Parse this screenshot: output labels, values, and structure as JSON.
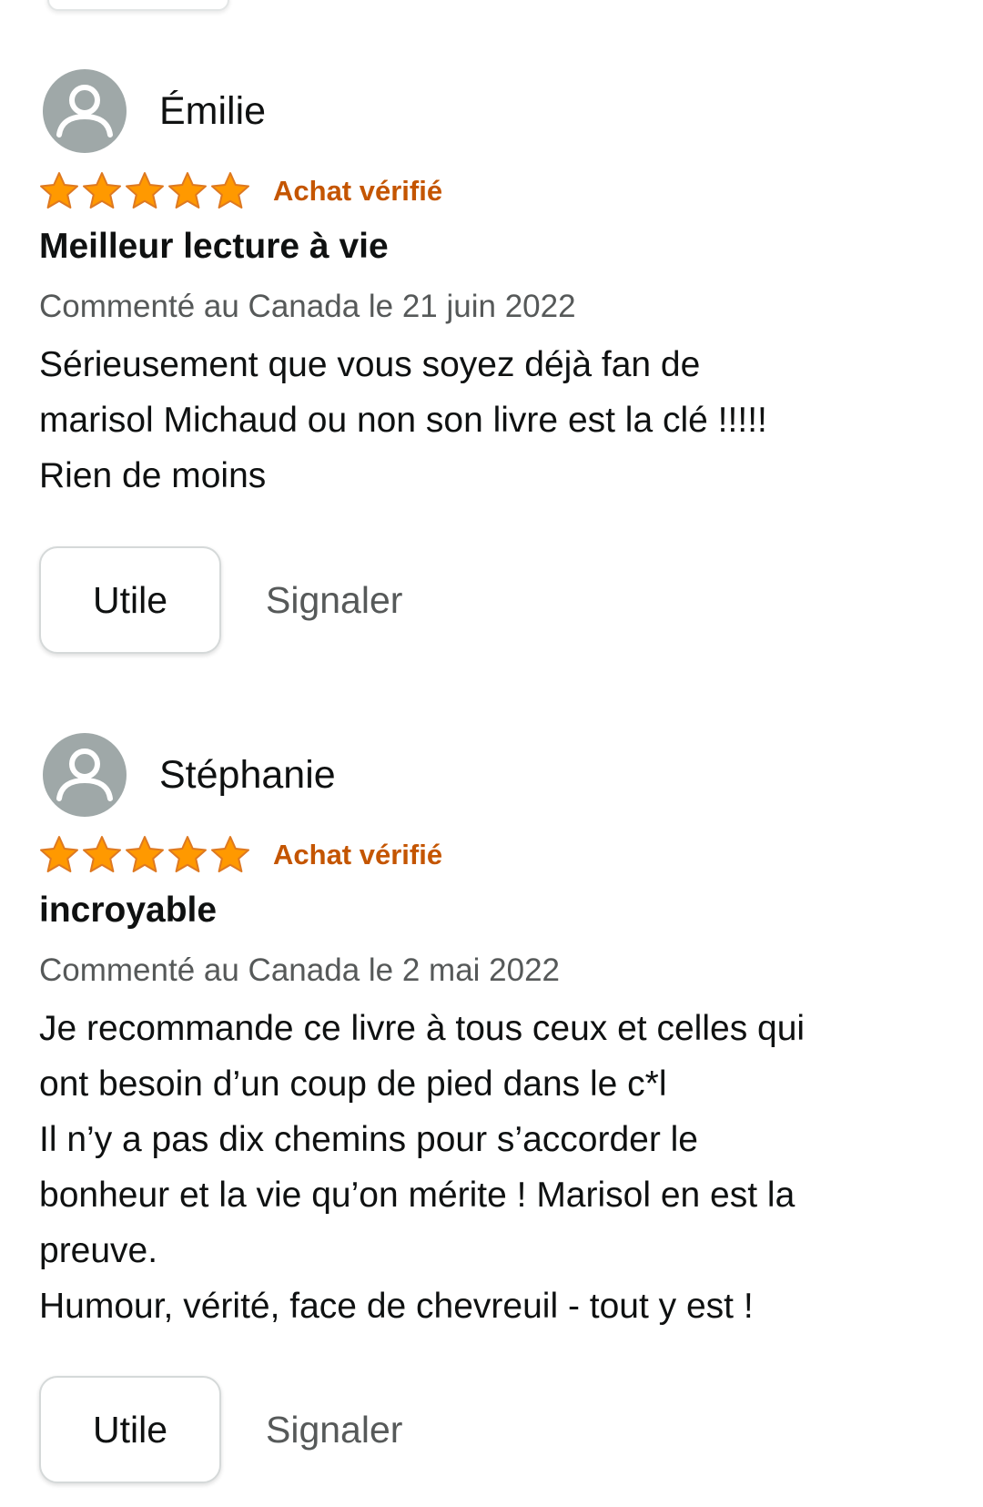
{
  "reviews": [
    {
      "author": "Émilie",
      "avatar_icon": "default-user-avatar-icon",
      "rating": 5,
      "rating_max": 5,
      "verified_label": "Achat vérifié",
      "title": "Meilleur lecture à vie",
      "date_text": "Commenté au Canada le 21 juin 2022",
      "body_lines": [
        "Sérieusement que vous soyez déjà fan de",
        "marisol Michaud ou non son livre est la clé !!!!!",
        "Rien de moins"
      ],
      "helpful_label": "Utile",
      "report_label": "Signaler"
    },
    {
      "author": "Stéphanie",
      "avatar_icon": "default-user-avatar-icon",
      "rating": 5,
      "rating_max": 5,
      "verified_label": "Achat vérifié",
      "title": "incroyable",
      "date_text": "Commenté au Canada le 2 mai 2022",
      "body_lines": [
        "Je recommande ce livre à tous ceux et celles qui",
        "ont besoin d’un coup de pied dans le c*l",
        "Il n’y a pas dix chemins pour s’accorder le",
        "bonheur et la vie qu’on mérite ! Marisol en est la",
        "preuve.",
        "Humour, vérité, face de chevreuil - tout y est !"
      ],
      "helpful_label": "Utile",
      "report_label": "Signaler"
    }
  ],
  "colors": {
    "star_fill": "#ff9900",
    "star_outline": "#de7921",
    "verified_text": "#c45500",
    "avatar_bg": "#9fa8a8",
    "muted_text": "#565959",
    "main_text": "#0f1111",
    "button_border": "#d5d9d9"
  }
}
